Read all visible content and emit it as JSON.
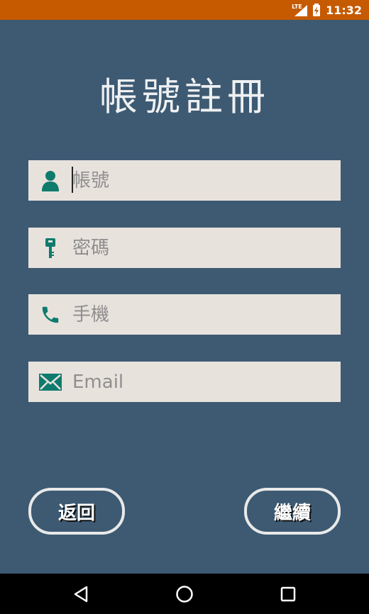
{
  "status_bar": {
    "network": "LTE",
    "time": "11:32"
  },
  "page": {
    "title": "帳號註冊"
  },
  "form": {
    "account_placeholder": "帳號",
    "password_placeholder": "密碼",
    "phone_placeholder": "手機",
    "email_placeholder": "Email"
  },
  "buttons": {
    "back_label": "返回",
    "continue_label": "繼續"
  },
  "icons": {
    "account": "person-icon",
    "password": "key-icon",
    "phone": "phone-icon",
    "email": "mail-icon"
  },
  "colors": {
    "status_bar": "#c55a00",
    "background": "#3d5a72",
    "field_bg": "#e8e2dd",
    "icon": "#0e7b6d"
  }
}
